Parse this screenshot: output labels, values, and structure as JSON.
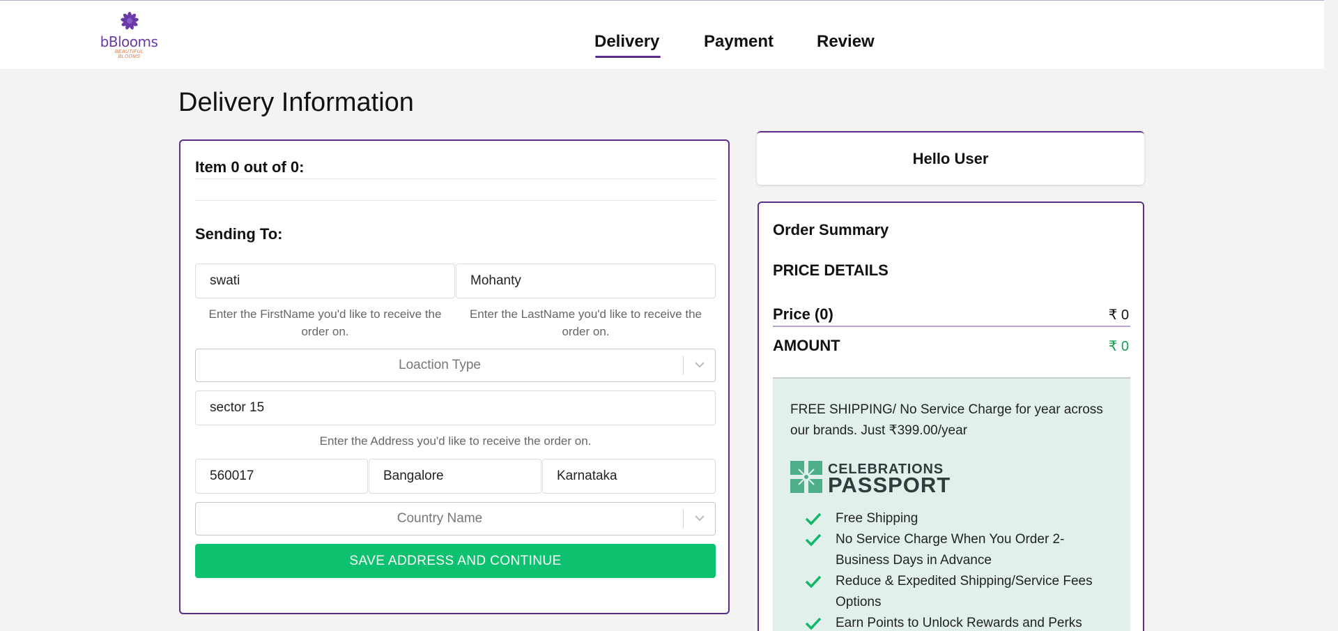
{
  "brand": {
    "name": "bBlooms",
    "tagline": "BEAUTIFUL BLOOMS",
    "primary_color": "#5b2d8a",
    "accent_green": "#0dc16e"
  },
  "nav": {
    "tabs": [
      {
        "label": "Delivery",
        "active": true
      },
      {
        "label": "Payment",
        "active": false
      },
      {
        "label": "Review",
        "active": false
      }
    ]
  },
  "page": {
    "title": "Delivery Information"
  },
  "form": {
    "item_count": "Item 0 out of 0:",
    "sending_to": "Sending To:",
    "first_name": {
      "value": "swati",
      "hint": "Enter the FirstName you'd like to receive the order on."
    },
    "last_name": {
      "value": "Mohanty",
      "hint": "Enter the LastName you'd like to receive the order on."
    },
    "location_type": {
      "placeholder": "Loaction Type"
    },
    "address": {
      "value": "sector 15",
      "hint": "Enter the Address you'd like to receive the order on."
    },
    "pincode": {
      "value": "560017"
    },
    "city": {
      "value": "Bangalore"
    },
    "state": {
      "value": "Karnataka"
    },
    "country": {
      "placeholder": "Country Name"
    },
    "save_label": "SAVE ADDRESS AND CONTINUE"
  },
  "greeting": {
    "text": "Hello User"
  },
  "summary": {
    "title": "Order Summary",
    "price_details": "PRICE DETAILS",
    "price_label": "Price (0)",
    "price_value": "₹ 0",
    "amount_label": "AMOUNT",
    "amount_value": "₹ 0",
    "promo": {
      "text": "FREE SHIPPING/ No Service Charge for year across our brands. Just ₹399.00/year",
      "passport_line1": "CELEBRATIONS",
      "passport_line2": "PASSPORT",
      "benefits": [
        "Free Shipping",
        "No Service Charge When You Order 2-Business Days in Advance",
        "Reduce & Expedited Shipping/Service Fees Options",
        "Earn Points to Unlock Rewards and Perks"
      ]
    }
  }
}
